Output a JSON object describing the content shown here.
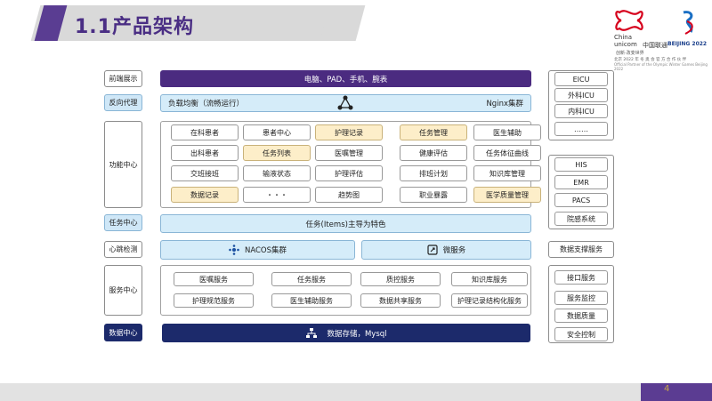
{
  "header": {
    "title": "1.1产品架构"
  },
  "logo": {
    "en1": "China",
    "en2": "unicom",
    "cn": "中国联通",
    "slogan": "创新·改变世界",
    "olympic": "BEIJING 2022",
    "sub1": "北京 2022 年 冬 奥 会 官 方 合 作 伙 伴",
    "sub2": "Official Partner of the Olympic Winter Games Beijing 2022"
  },
  "labels": {
    "frontend": "前端展示",
    "proxy": "反向代理",
    "function": "功能中心",
    "task": "任务中心",
    "heartbeat": "心跳检测",
    "service": "服务中心",
    "data": "数据中心"
  },
  "rows": {
    "frontend": "电脑、PAD、手机、腕表",
    "proxy_left": "负载均衡（流畅运行）",
    "proxy_right": "Nginx集群",
    "task": "任务(Items)主导为特色",
    "heartbeat_left": "NACOS集群",
    "heartbeat_right": "微服务",
    "data": "数据存储，Mysql"
  },
  "function_grid": [
    [
      "在科患者",
      "患者中心",
      "护理记录",
      "任务管理",
      "医生辅助"
    ],
    [
      "出科患者",
      "任务列表",
      "医嘱管理",
      "健康评估",
      "任务体征曲线"
    ],
    [
      "交班接班",
      "输液状态",
      "护理评估",
      "排班计划",
      "知识库管理"
    ],
    [
      "数据记录",
      "・・・",
      "趋势图",
      "职业暴露",
      "医学质量管理"
    ]
  ],
  "function_highlight": [
    [
      false,
      false,
      true,
      true,
      false
    ],
    [
      false,
      true,
      false,
      false,
      false
    ],
    [
      false,
      false,
      false,
      false,
      false
    ],
    [
      true,
      false,
      false,
      false,
      true
    ]
  ],
  "services": [
    [
      "医嘱服务",
      "任务服务",
      "质控服务",
      "知识库服务"
    ],
    [
      "护理规范服务",
      "医生辅助服务",
      "数据共享服务",
      "护理记录结构化服务"
    ]
  ],
  "right": {
    "group1": [
      "EICU",
      "外科ICU",
      "内科ICU",
      "……"
    ],
    "group2": [
      "HIS",
      "EMR",
      "PACS",
      "院感系统"
    ],
    "support": "数据支撑服务",
    "group3": [
      "接口服务",
      "服务监控",
      "数据质量",
      "安全控制"
    ]
  },
  "footer": {
    "page": "4"
  },
  "colors": {
    "purple": "#4b2b80",
    "navy": "#1c2a6b",
    "light_blue": "#d5ecf9",
    "yellow": "#fdeec9"
  }
}
